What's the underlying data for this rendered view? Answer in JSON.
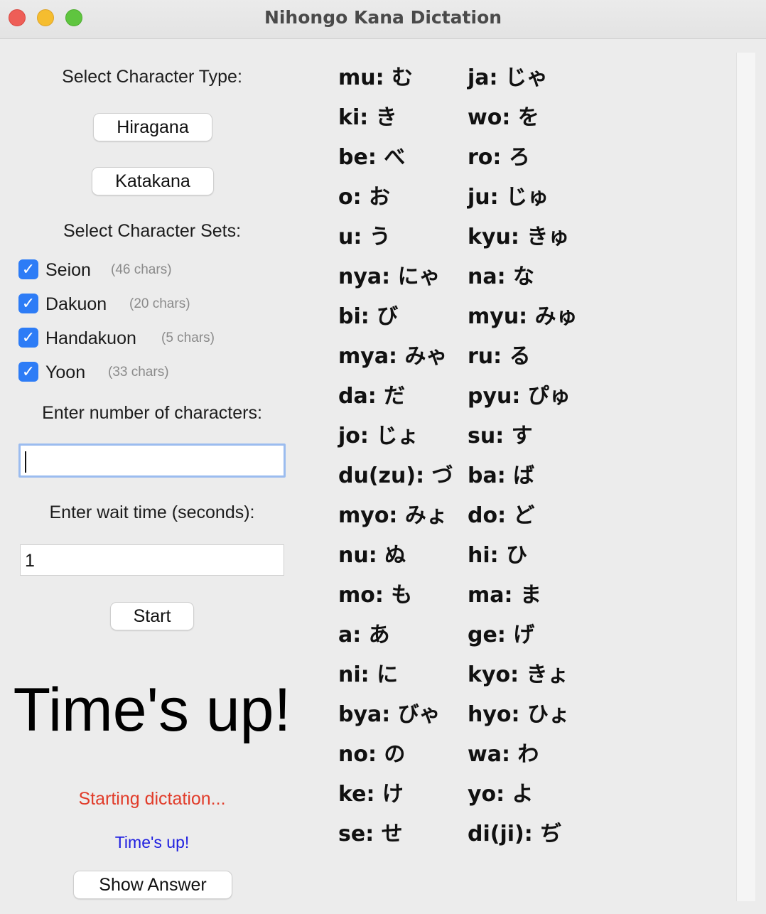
{
  "window": {
    "title": "Nihongo Kana Dictation"
  },
  "left": {
    "select_type_label": "Select Character Type:",
    "hiragana_button": "Hiragana",
    "katakana_button": "Katakana",
    "select_sets_label": "Select Character Sets:",
    "sets": [
      {
        "label": "Seion",
        "count": "(46 chars)",
        "checked": true
      },
      {
        "label": "Dakuon",
        "count": "(20 chars)",
        "checked": true
      },
      {
        "label": "Handakuon",
        "count": "(5 chars)",
        "checked": true
      },
      {
        "label": "Yoon",
        "count": "(33 chars)",
        "checked": true
      }
    ],
    "num_chars_label": "Enter number of characters:",
    "num_chars_value": "",
    "wait_time_label": "Enter wait time (seconds):",
    "wait_time_value": "1",
    "start_button": "Start",
    "big_status": "Time's up!",
    "status_red": "Starting dictation...",
    "status_blue": "Time's up!",
    "show_answer_button": "Show Answer",
    "colors": {
      "checkbox": "#2d7cf6",
      "status_red": "#e13c2a",
      "status_blue": "#1e1ee0"
    }
  },
  "answers": {
    "col1": [
      "mu: む",
      "ki: き",
      "be: べ",
      "o: お",
      "u: う",
      "nya: にゃ",
      "bi: び",
      "mya: みゃ",
      "da: だ",
      "jo: じょ",
      "du(zu): づ",
      "myo: みょ",
      "nu: ぬ",
      "mo: も",
      "a: あ",
      "ni: に",
      "bya: びゃ",
      "no: の",
      "ke: け",
      "se: せ"
    ],
    "col2": [
      "ja: じゃ",
      "wo: を",
      "ro: ろ",
      "ju: じゅ",
      "kyu: きゅ",
      "na: な",
      "myu: みゅ",
      "ru: る",
      "pyu: ぴゅ",
      "su: す",
      "ba: ば",
      "do: ど",
      "hi: ひ",
      "ma: ま",
      "ge: げ",
      "kyo: きょ",
      "hyo: ひょ",
      "wa: わ",
      "yo: よ",
      "di(ji): ぢ"
    ]
  }
}
